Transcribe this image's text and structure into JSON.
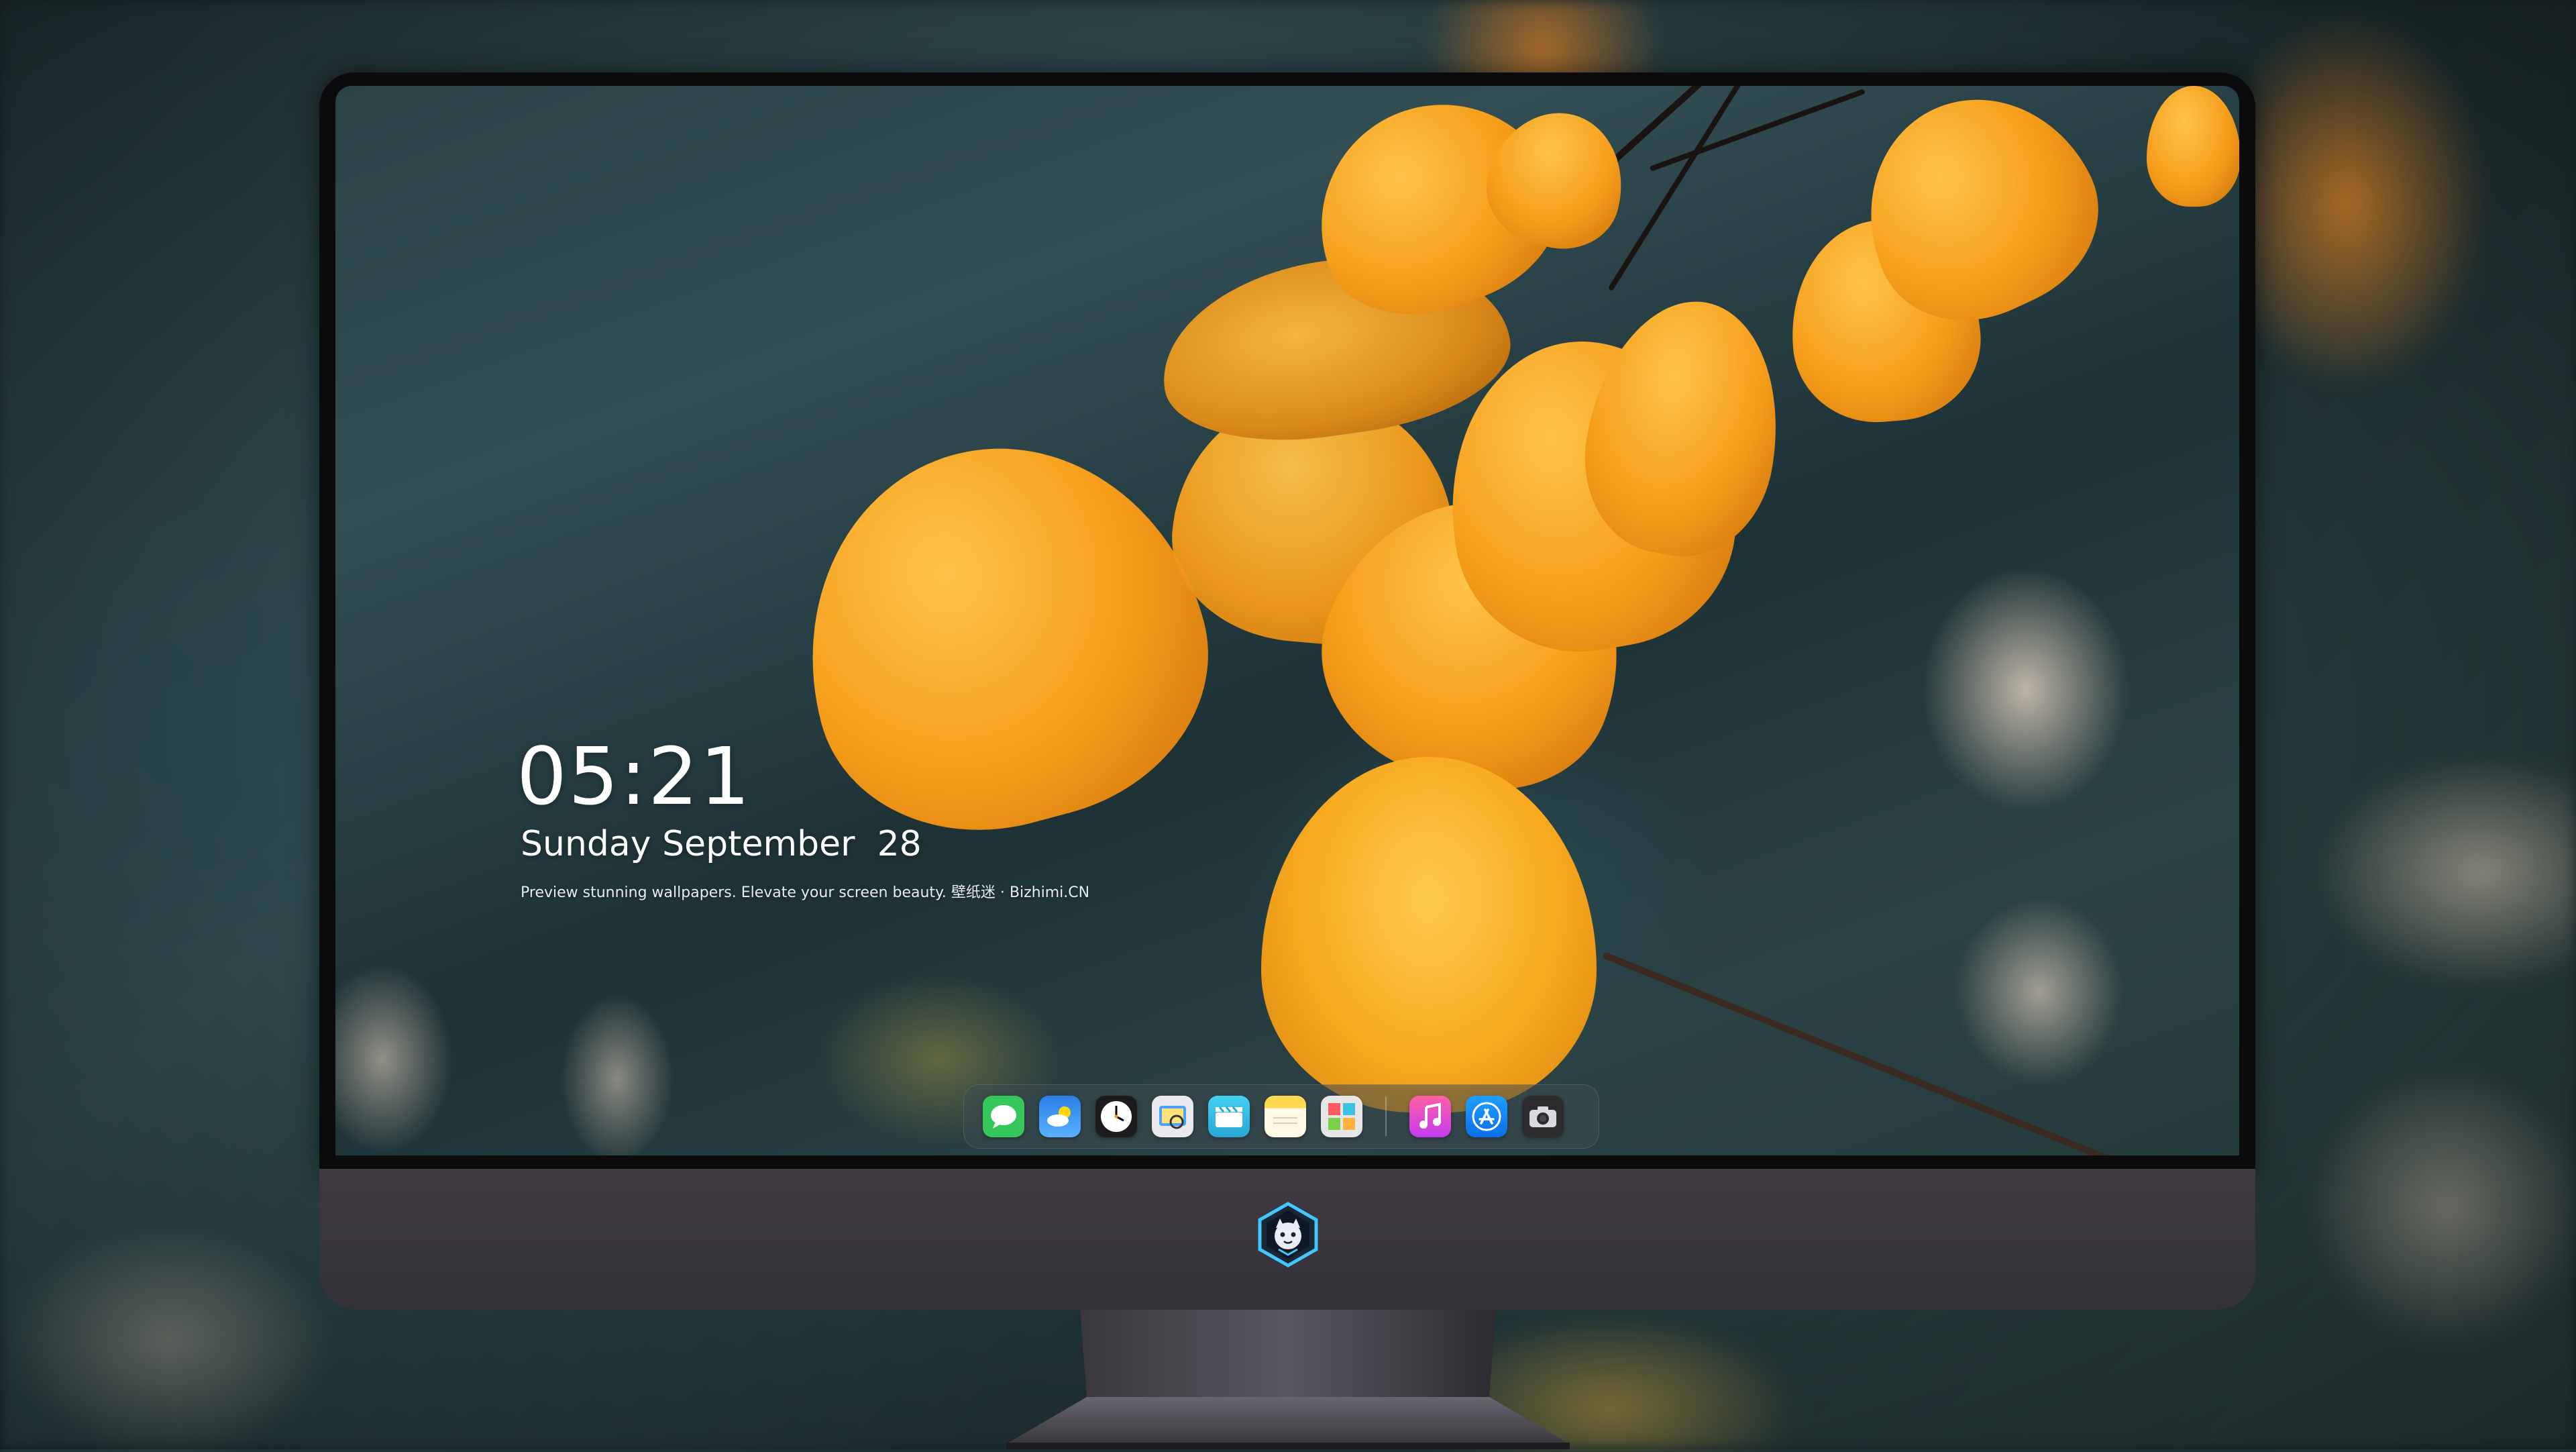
{
  "lockscreen": {
    "time": "05:21",
    "date": "Sunday September  28",
    "tagline": "Preview stunning wallpapers. Elevate your screen beauty. 壁纸迷 · Bizhimi.CN"
  },
  "dock": {
    "apps": [
      {
        "name": "Messages",
        "icon": "messages-icon",
        "color": "#34c759"
      },
      {
        "name": "Weather",
        "icon": "weather-icon",
        "color": "#2f8ff0"
      },
      {
        "name": "Clock",
        "icon": "clock-icon",
        "color": "#1c1c1e"
      },
      {
        "name": "Preview",
        "icon": "preview-icon",
        "color": "#e9e9ee"
      },
      {
        "name": "Clips",
        "icon": "clips-icon",
        "color": "#3ec1e0"
      },
      {
        "name": "Notes",
        "icon": "notes-icon",
        "color": "#fbe17a"
      },
      {
        "name": "Photo Booth",
        "icon": "photo-booth-icon",
        "color": "#e6e6e6"
      },
      {
        "name": "Music",
        "icon": "music-icon",
        "color": "#fc3c8d"
      },
      {
        "name": "App Store",
        "icon": "app-store-icon",
        "color": "#1e90ff"
      },
      {
        "name": "Camera",
        "icon": "camera-icon",
        "color": "#2c2c2e"
      }
    ]
  },
  "brand": {
    "logo": "bizhimi-logo-icon",
    "accent": "#3ec8ff"
  }
}
